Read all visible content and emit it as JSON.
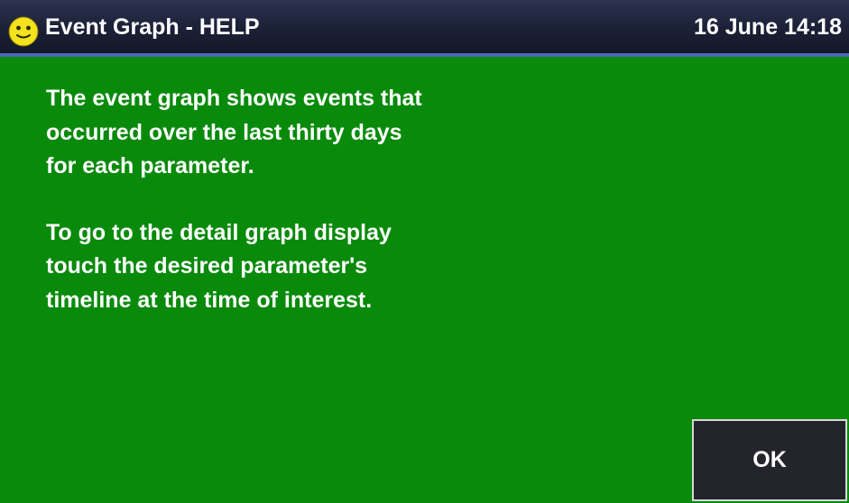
{
  "header": {
    "title": "Event Graph - HELP",
    "datetime": "16 June 14:18",
    "status_icon": "smiley-face-icon"
  },
  "help": {
    "paragraph1": [
      "The event graph shows events that",
      "occurred over the last thirty days",
      "for each parameter."
    ],
    "paragraph2": [
      "To go to the detail graph display",
      "touch the desired parameter's",
      "timeline at the time of interest."
    ]
  },
  "actions": {
    "ok_label": "OK"
  },
  "colors": {
    "background": "#098a0b",
    "title_bar": "#1b2036",
    "title_bar_accent": "#4a67b8",
    "button_background": "#24242c",
    "text": "#ffffff",
    "icon_face": "#f4e21c"
  }
}
